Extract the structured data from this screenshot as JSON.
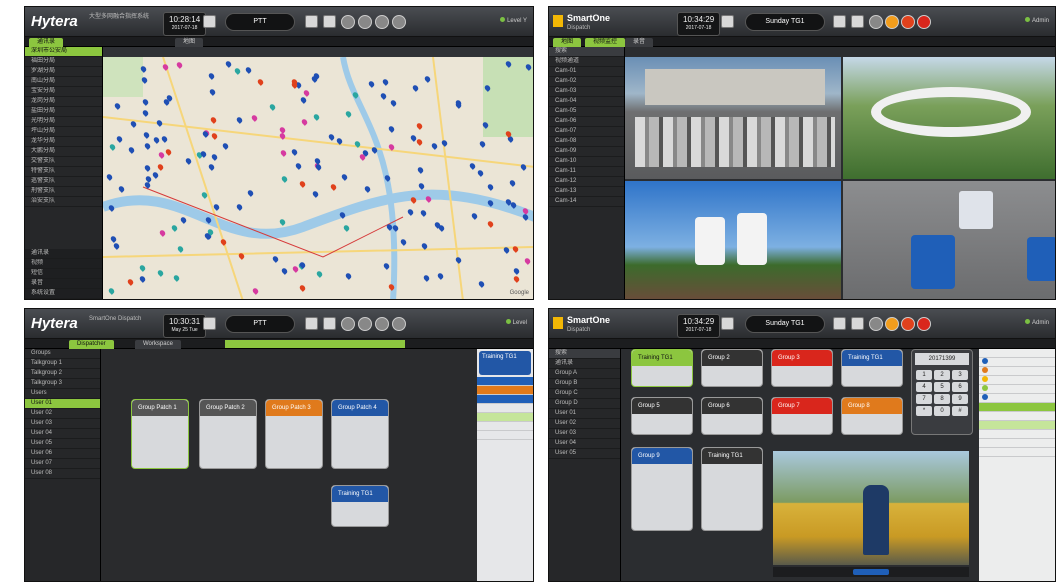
{
  "colors": {
    "accent": "#8cc63f",
    "blue": "#2257a6",
    "orange": "#e07a1c",
    "red": "#d9261c",
    "dark": "#2b2d30"
  },
  "p1": {
    "brand": "Hytera",
    "sub": "大型多网融合指挥系统",
    "time": "10:28:14",
    "date": "2017-07-18",
    "ptt": "PTT",
    "status": "Level Y",
    "tabs": [
      "通讯录",
      "地图"
    ],
    "tree": [
      "深圳市公安局",
      "福田分局",
      "罗湖分局",
      "南山分局",
      "宝安分局",
      "龙岗分局",
      "盐田分局",
      "光明分局",
      "坪山分局",
      "龙华分局",
      "大鹏分局",
      "交警支队",
      "特警支队",
      "巡警支队",
      "刑警支队",
      "治安支队"
    ],
    "bottom": [
      "通讯录",
      "视频",
      "短信",
      "录音",
      "系统设置"
    ],
    "map_label": "Google"
  },
  "p2": {
    "brand": "SmartOne",
    "sub": "Dispatch",
    "time": "10:34:29",
    "date": "2017-07-18",
    "ptt": "Sunday TG1",
    "status": "Admin",
    "tabs": [
      "地图",
      "视频监控",
      "录音"
    ],
    "search": "搜索",
    "tree": [
      "视频通道",
      "Cam-01",
      "Cam-02",
      "Cam-03",
      "Cam-04",
      "Cam-05",
      "Cam-06",
      "Cam-07",
      "Cam-08",
      "Cam-09",
      "Cam-10",
      "Cam-11",
      "Cam-12",
      "Cam-13",
      "Cam-14"
    ]
  },
  "p3": {
    "brand": "Hytera",
    "sub": "SmartOne Dispatch",
    "time": "10:30:31",
    "date": "May 25 Tue",
    "ptt": "PTT",
    "status": "Level",
    "tabs": [
      "Dispatcher",
      "Workspace"
    ],
    "tree": [
      "Groups",
      "Talkgroup 1",
      "Talkgroup 2",
      "Talkgroup 3",
      "Users",
      "User 01",
      "User 02",
      "User 03",
      "User 04",
      "User 05",
      "User 06",
      "User 07",
      "User 08"
    ],
    "cards": [
      {
        "label": "Group Patch 1",
        "color": "#555"
      },
      {
        "label": "Group Patch 2",
        "color": "#555"
      },
      {
        "label": "Group Patch 3",
        "color": "#e07a1c"
      },
      {
        "label": "Group Patch 4",
        "color": "#2257a6"
      },
      {
        "label": "Training TG1",
        "color": "#2257a6"
      }
    ],
    "right_title": "Training TG1"
  },
  "p4": {
    "brand": "SmartOne",
    "sub": "Dispatch",
    "time": "10:34:29",
    "date": "2017-07-18",
    "ptt": "Sunday TG1",
    "status": "Admin",
    "search": "搜索",
    "tree": [
      "通讯录",
      "Group A",
      "Group B",
      "Group C",
      "Group D",
      "User 01",
      "User 02",
      "User 03",
      "User 04",
      "User 05"
    ],
    "cards": [
      {
        "label": "Training TG1",
        "color": "#8cc63f"
      },
      {
        "label": "Group 2",
        "color": "#333"
      },
      {
        "label": "Group 3",
        "color": "#d9261c"
      },
      {
        "label": "Training TG1",
        "color": "#2257a6"
      },
      {
        "label": "Group 5",
        "color": "#333"
      },
      {
        "label": "Group 6",
        "color": "#333"
      },
      {
        "label": "Group 7",
        "color": "#d9261c"
      },
      {
        "label": "Group 8",
        "color": "#e07a1c"
      },
      {
        "label": "Group 9",
        "color": "#2257a6"
      },
      {
        "label": "Training TG1",
        "color": "#333"
      }
    ],
    "keypad": [
      "1",
      "2",
      "3",
      "4",
      "5",
      "6",
      "7",
      "8",
      "9",
      "*",
      "0",
      "#"
    ],
    "keypad_display": "20171399"
  }
}
